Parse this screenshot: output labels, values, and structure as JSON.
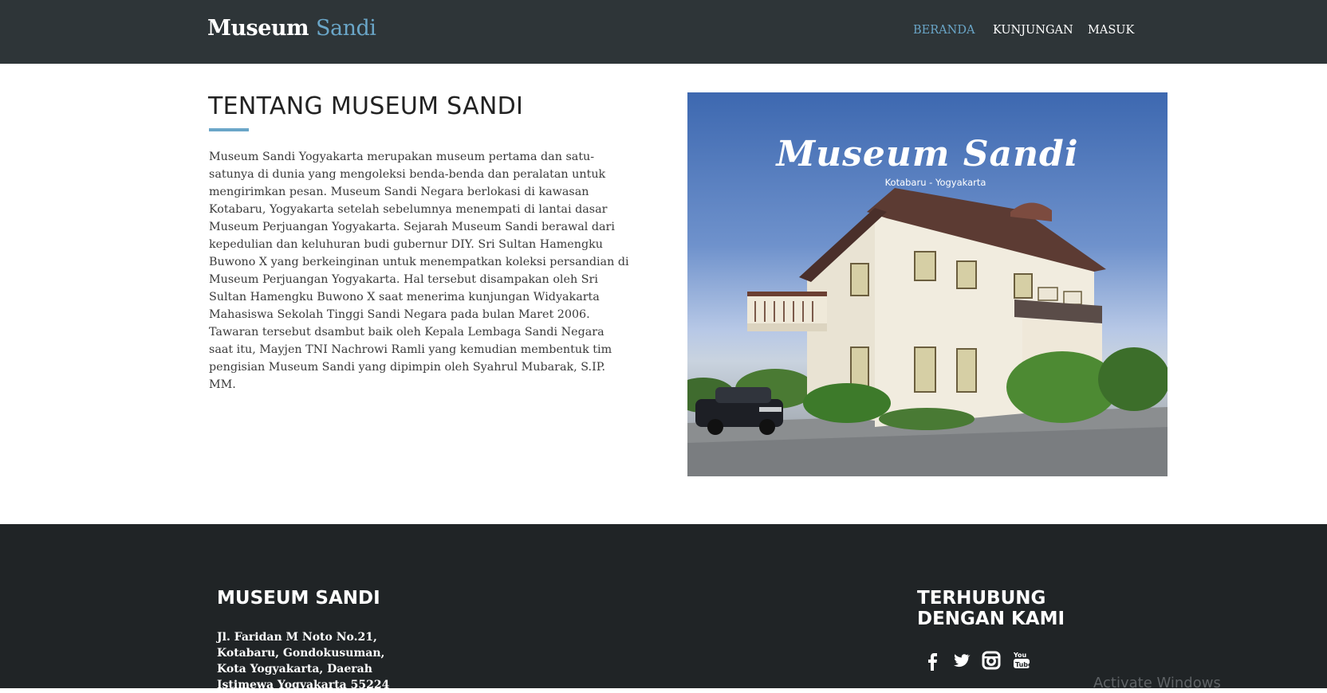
{
  "brand": {
    "part1": "Museum",
    "part2": "Sandi"
  },
  "nav": {
    "items": [
      "BERANDA",
      "KUNJUNGAN",
      "MASUK"
    ],
    "active": "BERANDA"
  },
  "about": {
    "title": "TENTANG MUSEUM SANDI",
    "text": "Museum Sandi Yogyakarta merupakan museum pertama dan satu-satunya di dunia yang mengoleksi benda-benda dan peralatan untuk mengirimkan pesan. Museum Sandi Negara berlokasi di kawasan Kotabaru, Yogyakarta setelah sebelumnya menempati di lantai dasar Museum Perjuangan Yogyakarta. Sejarah Museum Sandi berawal dari kepedulian dan keluhuran budi gubernur DIY. Sri Sultan Hamengku Buwono X yang berkeinginan untuk menempatkan koleksi persandian di Museum Perjuangan Yogyakarta. Hal tersebut disampakan oleh Sri Sultan Hamengku Buwono X saat menerima kunjungan Widyakarta Mahasiswa Sekolah Tinggi Sandi Negara pada bulan Maret 2006. Tawaran tersebut dsambut baik oleh Kepala Lembaga Sandi Negara saat itu, Mayjen TNI Nachrowi Ramli yang kemudian membentuk tim pengisian Museum Sandi yang dipimpin oleh Syahrul Mubarak, S.IP. MM."
  },
  "photo": {
    "overlay_title": "Museum Sandi",
    "overlay_subtitle": "Kotabaru - Yogyakarta"
  },
  "footer": {
    "title": "MUSEUM SANDI",
    "address": "Jl. Faridan M Noto No.21, Kotabaru, Gondokusuman, Kota Yogyakarta, Daerah Istimewa Yogyakarta 55224",
    "contact_title": "TERHUBUNG DENGAN KAMI",
    "socials": [
      "facebook-icon",
      "twitter-icon",
      "instagram-icon",
      "youtube-icon"
    ]
  },
  "watermark": "Activate Windows",
  "colors": {
    "navbar_bg": "#2e3538",
    "accent": "#6aa6c8",
    "footer_bg": "#202426"
  }
}
